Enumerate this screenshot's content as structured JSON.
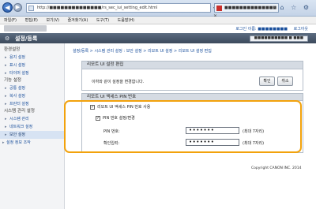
{
  "browser": {
    "back": "◀",
    "forward": "▶",
    "url": "http://■■■■■■■■■■■■■■/rs_sec_iui_setting_edit.html",
    "url_tools": "▾ ✕ ⟳",
    "tab_title": "■■■■■■■■■■■■■■",
    "tab_close": "×",
    "window_icons": "⌂ ☆ ⚙"
  },
  "menu": [
    "파일(F)",
    "편집(E)",
    "보기(V)",
    "즐겨찾기(A)",
    "도구(T)",
    "도움말(H)"
  ],
  "header": {
    "links": [
      "로그인 이름: ■■■■■■■■",
      "로그아웃"
    ],
    "title_icon": "⚙",
    "title": "설정/등록",
    "portal_button": "■■■■■■■■■■ ■ ■■■"
  },
  "sidebar": {
    "sections": [
      {
        "heading": "환경설정",
        "items": [
          "용지 설정",
          "표시 설정",
          "타이머 설정"
        ]
      },
      {
        "heading": "기능 설정",
        "items": [
          "공통 설정",
          "복사 설정",
          "프린터 설정"
        ]
      },
      {
        "heading": "시스템 관리 설정",
        "items": [
          "시스템 관리",
          "네트워크 설정",
          "보안 설정"
        ]
      }
    ],
    "bottom_item": "설정 정보 조작"
  },
  "breadcrumb": "설정/등록 > 시스템 관리 설정 : 보안 설정 > 리모트 UI 설정 > 리모트 UI 설정 편집",
  "panel_edit": {
    "title": "리모트 UI 설정 편집",
    "message": "이하와 같이 설정을 변경합니다.",
    "ok_label": "확인",
    "cancel_label": "취소"
  },
  "panel_pin": {
    "title": "리모트 UI 액세스 PIN 번호",
    "use_pin_label": "리모트 UI 액세스 PIN 번호 사용",
    "use_pin_checked": "✓",
    "set_pin_label": "PIN 번호 설정/변경",
    "set_pin_checked": "✓",
    "pin_label": "PIN 번호:",
    "pin_value": "•••••••",
    "pin_hint": "(최대 7자리)",
    "confirm_label": "확인입력:",
    "confirm_value": "•••••••",
    "confirm_hint": "(최대 7자리)"
  },
  "footer": {
    "copyright": "Copyright CANON INC. 2014"
  },
  "colors": {
    "highlight": "#f2a20c",
    "title_bar": "#3c4a5c",
    "link": "#1a4f9c"
  }
}
